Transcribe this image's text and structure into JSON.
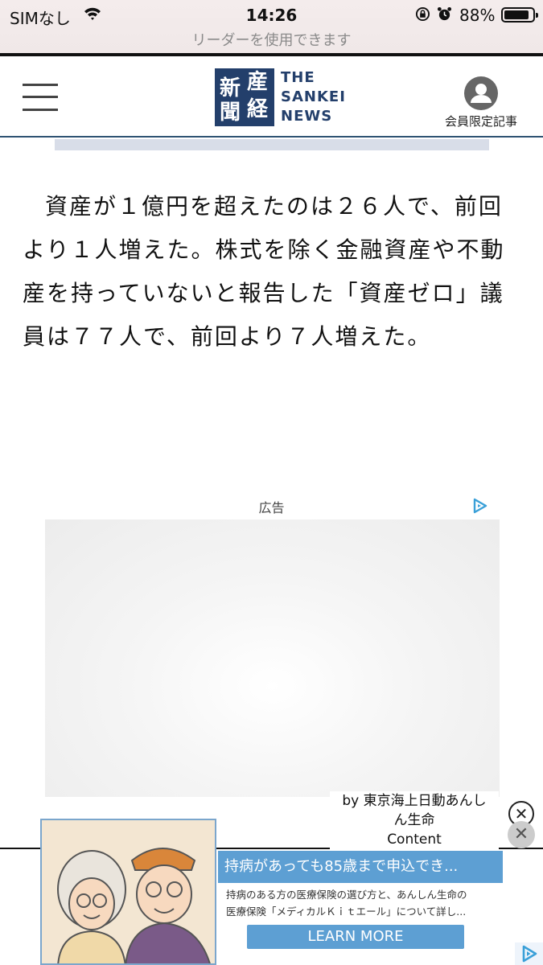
{
  "status_bar": {
    "carrier": "SIMなし",
    "time": "14:26",
    "battery": "88%",
    "battery_level": 0.88,
    "reader_hint": "リーダーを使用できます"
  },
  "header": {
    "logo_kanji": [
      "産",
      "経",
      "新",
      "聞"
    ],
    "logo_words": [
      "THE",
      "SANKEI",
      "NEWS"
    ],
    "member_label": "会員限定記事",
    "colors": {
      "brand": "#233f6b",
      "rule": "#2f5373"
    }
  },
  "article": {
    "body": "資産が１億円を超えたのは２６人で、前回より１人増えた。株式を除く金融資産や不動産を持っていないと報告した「資産ゼロ」議員は７７人で、前回より７人増えた。"
  },
  "ad": {
    "label": "広告",
    "choices_icon": "adchoices-icon"
  },
  "sticky_ad": {
    "sponsor": [
      "by 東京海上日動あんし",
      "ん生命",
      "Content"
    ],
    "title": "持病があっても85歳まで申込でき...",
    "description": [
      "持病のある方の医療保険の選び方と、あんしん生命の",
      "医療保険「メディカルＫｉｔエール」について詳し..."
    ],
    "cta": "LEARN MORE",
    "close_symbol": "✕",
    "colors": {
      "accent": "#5d9fd3"
    }
  }
}
